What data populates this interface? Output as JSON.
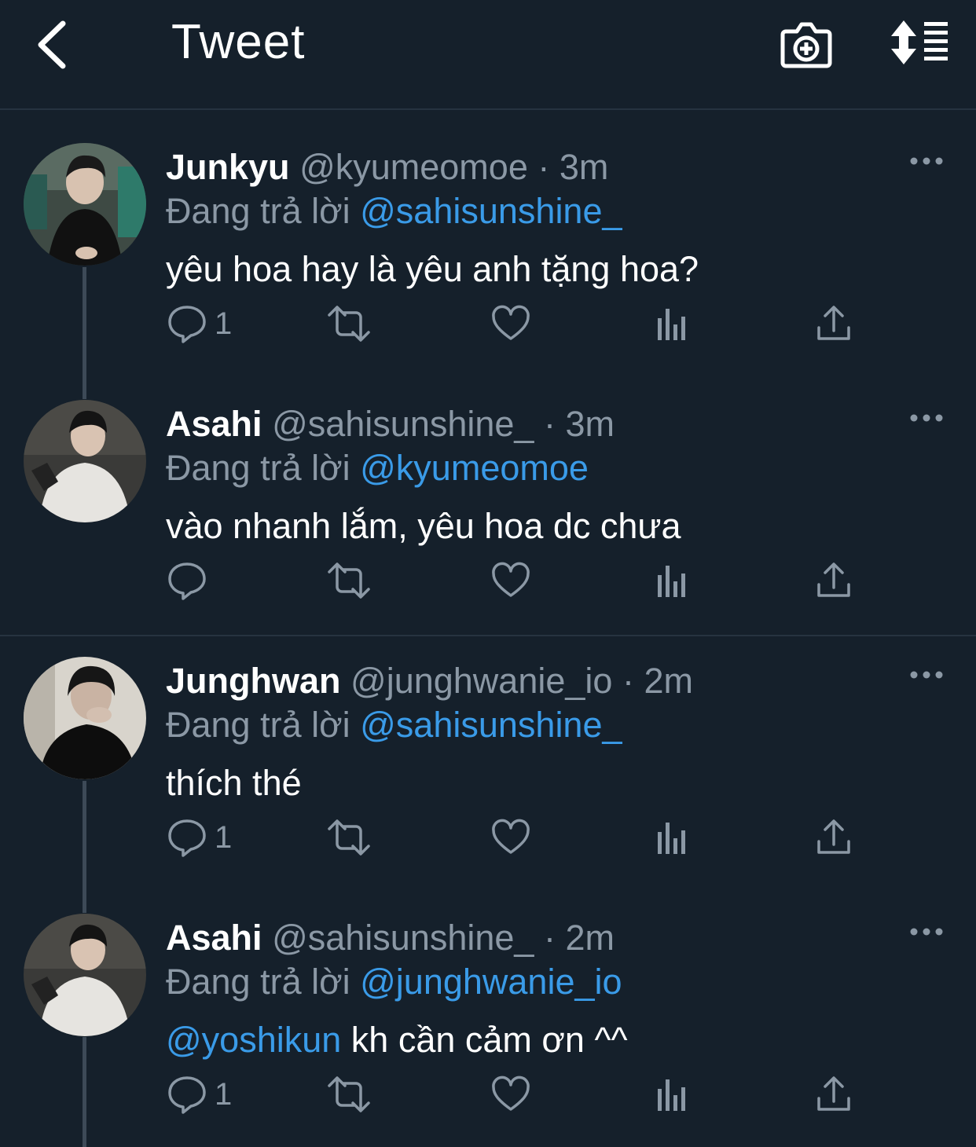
{
  "header": {
    "title": "Tweet",
    "back_icon": "chevron-left-icon",
    "camera_icon": "camera-plus-icon",
    "sort_icon": "sort-list-icon"
  },
  "colors": {
    "background": "#15202b",
    "link": "#3a9be8",
    "secondary_text": "#8b98a5",
    "divider": "#263340"
  },
  "tweets": [
    {
      "name": "Junkyu",
      "handle": "@kyumeomoe",
      "dot": "·",
      "time": "3m",
      "reply_prefix": "Đang trả lời",
      "reply_to": "@sahisunshine_",
      "text": "yêu hoa hay là yêu anh tặng hoa?",
      "reply_count": "1"
    },
    {
      "name": "Asahi",
      "handle": "@sahisunshine_",
      "dot": "·",
      "time": "3m",
      "reply_prefix": "Đang trả lời",
      "reply_to": "@kyumeomoe",
      "text": "vào nhanh lắm, yêu hoa dc chưa",
      "reply_count": ""
    },
    {
      "name": "Junghwan",
      "handle": "@junghwanie_io",
      "dot": "·",
      "time": "2m",
      "reply_prefix": "Đang trả lời",
      "reply_to": "@sahisunshine_",
      "text": "thích thé",
      "reply_count": "1"
    },
    {
      "name": "Asahi",
      "handle": "@sahisunshine_",
      "dot": "·",
      "time": "2m",
      "reply_prefix": "Đang trả lời",
      "reply_to": "@junghwanie_io",
      "text_mention": "@yoshikun",
      "text": " kh cần cảm ơn ^^",
      "reply_count": "1"
    }
  ]
}
